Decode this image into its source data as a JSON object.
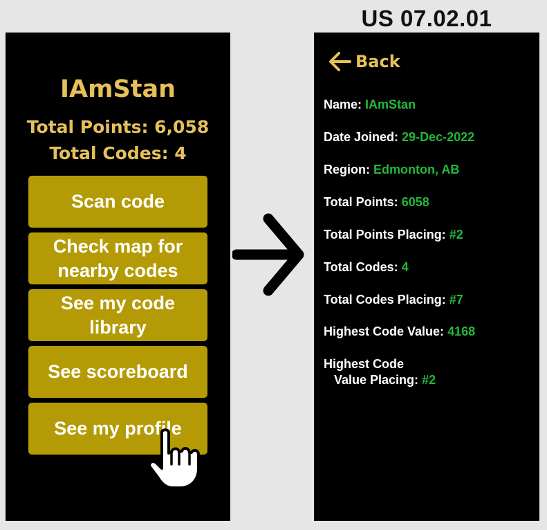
{
  "story_id": "US 07.02.01",
  "home": {
    "username": "IAmStan",
    "total_points": "Total Points: 6,058",
    "total_codes": "Total Codes: 4",
    "buttons": [
      "Scan code",
      "Check map for\nnearby codes",
      "See my code\nlibrary",
      "See scoreboard",
      "See my profile"
    ]
  },
  "profile": {
    "back_label": "Back",
    "fields": [
      {
        "label": "Name:",
        "value": "IAmStan"
      },
      {
        "label": "Date Joined:",
        "value": "29-Dec-2022"
      },
      {
        "label": "Region:",
        "value": "Edmonton, AB"
      },
      {
        "label": "Total Points:",
        "value": "6058"
      },
      {
        "label": "Total Points Placing:",
        "value": "#2"
      },
      {
        "label": "Total Codes:",
        "value": "4"
      },
      {
        "label": "Total Codes Placing:",
        "value": "#7"
      },
      {
        "label": "Highest Code Value:",
        "value": "4168"
      }
    ],
    "last_field": {
      "label_line1": "Highest Code",
      "label_line2": "Value Placing:",
      "value": "#2"
    }
  },
  "colors": {
    "accent": "#e6c15a",
    "button": "#b49b06",
    "value": "#22b83a",
    "screen": "#000000"
  },
  "icons": [
    "hand-pointer-icon",
    "arrow-right-icon",
    "arrow-left-icon"
  ]
}
